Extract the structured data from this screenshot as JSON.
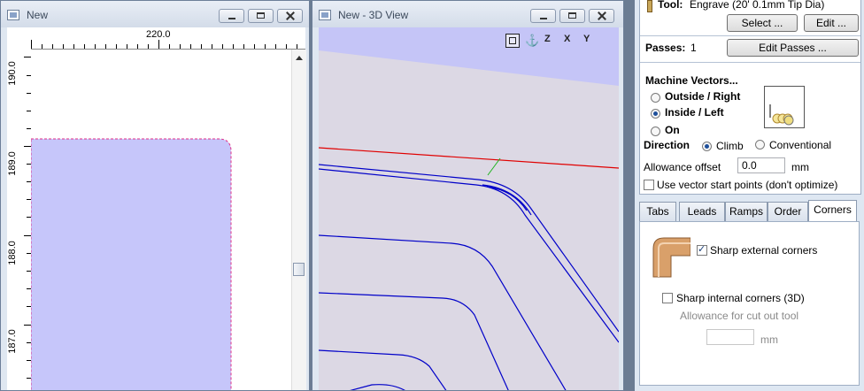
{
  "window_2d": {
    "title": "New"
  },
  "ruler": {
    "h_label": "220.0",
    "v_labels": [
      "190.0",
      "189.0",
      "188.0",
      "187.0"
    ]
  },
  "window_3d": {
    "title": "New - 3D View"
  },
  "view_icons": [
    "zoom-fit-icon",
    "iso-view-icon",
    "view-z-icon",
    "view-x-icon",
    "view-y-icon"
  ],
  "view_icon_labels": [
    "Z",
    "X",
    "Y"
  ],
  "tool": {
    "label": "Tool:",
    "value": "Engrave (20' 0.1mm Tip Dia)",
    "select_button": "Select ...",
    "edit_button": "Edit ..."
  },
  "passes": {
    "label": "Passes:",
    "value": "1",
    "edit_button": "Edit Passes ..."
  },
  "machine_vectors": {
    "heading": "Machine Vectors...",
    "options": [
      "Outside / Right",
      "Inside / Left",
      "On"
    ],
    "selected": "Inside / Left"
  },
  "direction": {
    "label": "Direction",
    "options": [
      "Climb",
      "Conventional"
    ],
    "selected": "Climb"
  },
  "allowance": {
    "label": "Allowance offset",
    "value": "0.0",
    "unit": "mm"
  },
  "vector_start": {
    "label": "Use vector start points (don't optimize)",
    "checked": false
  },
  "tabs": [
    "Tabs",
    "Leads",
    "Ramps",
    "Order",
    "Corners"
  ],
  "active_tab": "Corners",
  "corners": {
    "sharp_external": {
      "label": "Sharp external corners",
      "checked": true
    },
    "sharp_internal": {
      "label": "Sharp internal corners (3D)",
      "checked": false
    },
    "cutout_label": "Allowance for cut out tool",
    "cutout_value": "",
    "cutout_unit": "mm"
  },
  "colors": {
    "selection_fill": "#c6c6fa",
    "toolpath": "#0000c8",
    "red_vector": "#e00000",
    "sky": "#c5c5f7"
  }
}
